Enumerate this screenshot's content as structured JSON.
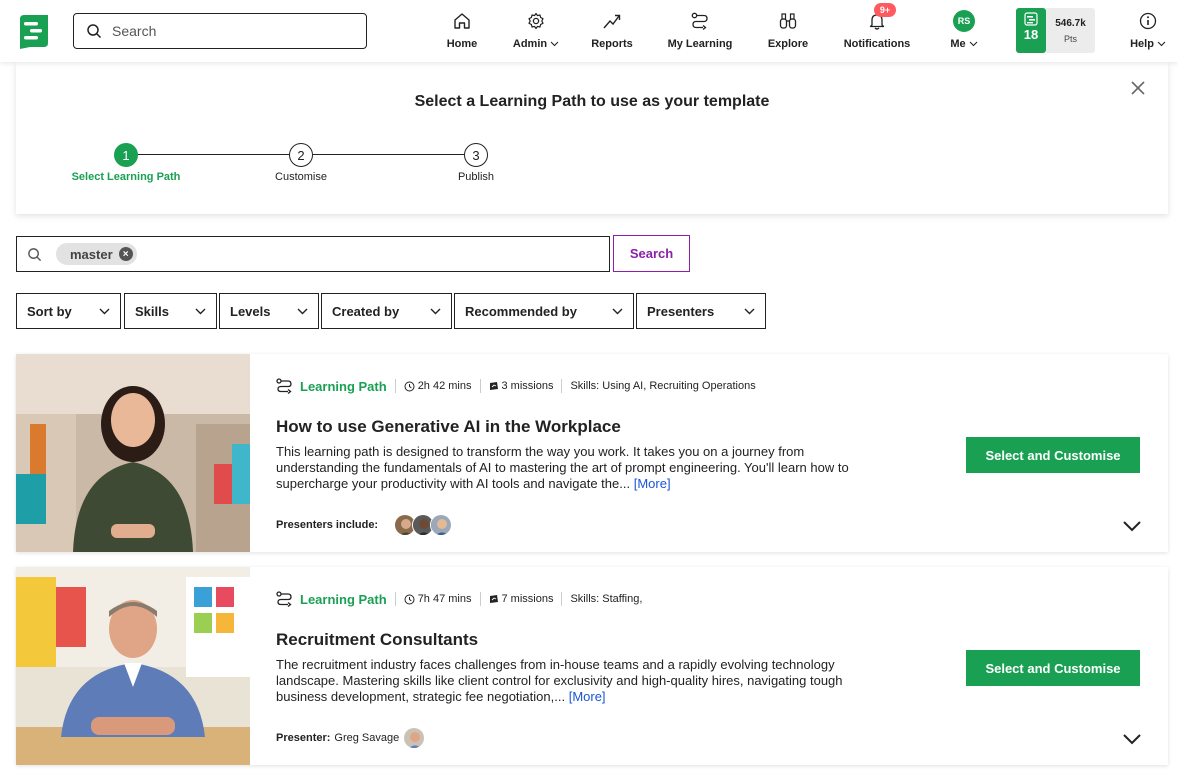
{
  "nav": {
    "search_placeholder": "Search",
    "items": [
      {
        "label": "Home",
        "icon": "home-icon"
      },
      {
        "label": "Admin",
        "icon": "gear-icon"
      },
      {
        "label": "Reports",
        "icon": "trend-icon"
      },
      {
        "label": "My Learning",
        "icon": "path-icon"
      },
      {
        "label": "Explore",
        "icon": "binoculars-icon"
      },
      {
        "label": "Notifications",
        "icon": "bell-icon"
      },
      {
        "label": "Me",
        "icon": "avatar"
      },
      {
        "label": "Help",
        "icon": "info-icon"
      }
    ],
    "notif_badge": "9+",
    "avatar_initials": "RS",
    "streak": "18",
    "points_value": "546.7k",
    "points_unit": "Pts"
  },
  "wizard": {
    "title": "Select a Learning Path to use as your template",
    "steps": [
      {
        "num": "1",
        "label": "Select Learning Path"
      },
      {
        "num": "2",
        "label": "Customise"
      },
      {
        "num": "3",
        "label": "Publish"
      }
    ]
  },
  "search": {
    "chip": "master",
    "chip_remove": "×",
    "button": "Search"
  },
  "filters": [
    "Sort by",
    "Skills",
    "Levels",
    "Created by",
    "Recommended by",
    "Presenters"
  ],
  "results": [
    {
      "type": "Learning Path",
      "duration": "2h 42 mins",
      "missions": "3 missions",
      "skills": "Skills: Using AI, Recruiting Operations",
      "title": "How to use Generative AI in the Workplace",
      "description": "This learning path is designed to transform the way you work. It takes you on a journey from understanding the fundamentals of AI to mastering the art of prompt engineering. You'll learn how to supercharge your productivity with AI tools and navigate the...",
      "more": "[More]",
      "presenters_label": "Presenters include:",
      "presenter_name": "",
      "button": "Select and Customise"
    },
    {
      "type": "Learning Path",
      "duration": "7h 47 mins",
      "missions": "7 missions",
      "skills": "Skills: Staffing,",
      "title": "Recruitment Consultants",
      "description": "The recruitment industry faces challenges from in-house teams and a rapidly evolving technology landscape. Mastering skills like client control for exclusivity and high-quality hires, navigating tough business development, strategic fee negotiation,...",
      "more": "[More]",
      "presenters_label": "Presenter:",
      "presenter_name": "Greg Savage",
      "button": "Select and Customise"
    }
  ],
  "colors": {
    "brand_green": "#1aa053",
    "search_purple": "#8b1fa9",
    "link_blue": "#1a55d6",
    "badge_red": "#ff5a5f"
  }
}
